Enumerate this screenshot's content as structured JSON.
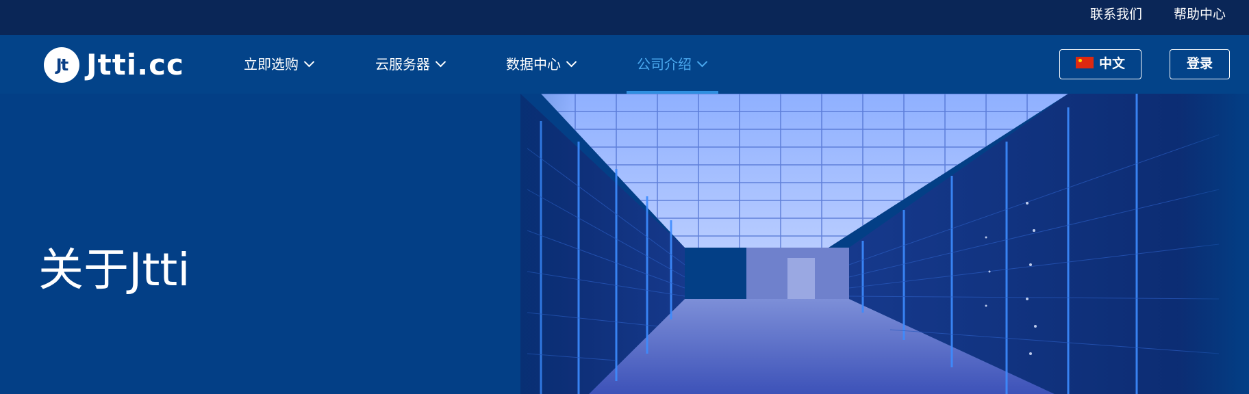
{
  "topbar": {
    "links": [
      "联系我们",
      "帮助中心"
    ]
  },
  "logo": {
    "badge": "Jt",
    "wordmark": "Jtti.cc"
  },
  "nav": {
    "items": [
      {
        "label": "立即选购"
      },
      {
        "label": "云服务器"
      },
      {
        "label": "数据中心"
      },
      {
        "label": "公司介绍",
        "active": true
      }
    ]
  },
  "header_buttons": {
    "language": "中文",
    "login": "登录"
  },
  "hero": {
    "title": "关于Jtti"
  },
  "colors": {
    "topbar_bg": "#0a2657",
    "nav_bg": "#034389",
    "hero_bg": "#033f86",
    "active_nav": "#4aa8ee",
    "rack_light": "#3d8cff"
  }
}
